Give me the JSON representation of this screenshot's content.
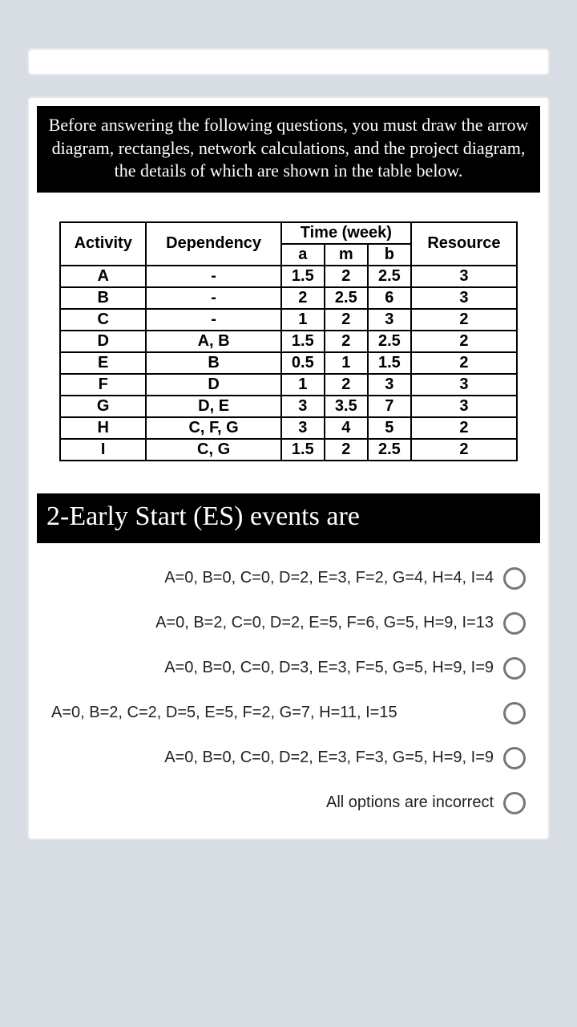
{
  "instruction": "Before answering the following questions, you must draw the arrow diagram, rectangles, network calculations, and the project diagram, the details of which are shown in the table below.",
  "headers": {
    "activity": "Activity",
    "dependency": "Dependency",
    "time_group": "Time (week)",
    "a": "a",
    "m": "m",
    "b": "b",
    "resource": "Resource"
  },
  "rows": [
    {
      "activity": "A",
      "dependency": "-",
      "a": "1.5",
      "m": "2",
      "b": "2.5",
      "resource": "3"
    },
    {
      "activity": "B",
      "dependency": "-",
      "a": "2",
      "m": "2.5",
      "b": "6",
      "resource": "3"
    },
    {
      "activity": "C",
      "dependency": "-",
      "a": "1",
      "m": "2",
      "b": "3",
      "resource": "2"
    },
    {
      "activity": "D",
      "dependency": "A, B",
      "a": "1.5",
      "m": "2",
      "b": "2.5",
      "resource": "2"
    },
    {
      "activity": "E",
      "dependency": "B",
      "a": "0.5",
      "m": "1",
      "b": "1.5",
      "resource": "2"
    },
    {
      "activity": "F",
      "dependency": "D",
      "a": "1",
      "m": "2",
      "b": "3",
      "resource": "3"
    },
    {
      "activity": "G",
      "dependency": "D, E",
      "a": "3",
      "m": "3.5",
      "b": "7",
      "resource": "3"
    },
    {
      "activity": "H",
      "dependency": "C, F, G",
      "a": "3",
      "m": "4",
      "b": "5",
      "resource": "2"
    },
    {
      "activity": "I",
      "dependency": "C, G",
      "a": "1.5",
      "m": "2",
      "b": "2.5",
      "resource": "2"
    }
  ],
  "question_title": "2-Early Start (ES) events are",
  "options": [
    "A=0, B=0, C=0, D=2, E=3, F=2, G=4, H=4, I=4",
    "A=0, B=2, C=0, D=2, E=5, F=6, G=5, H=9, I=13",
    "A=0, B=0, C=0, D=3, E=3, F=5, G=5, H=9, I=9",
    "A=0, B=2, C=2, D=5, E=5, F=2, G=7, H=11, I=15",
    "A=0, B=0, C=0, D=2, E=3, F=3, G=5, H=9, I=9",
    "All options are incorrect"
  ]
}
